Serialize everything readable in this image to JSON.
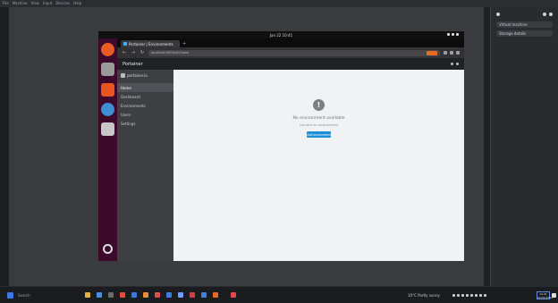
{
  "host": {
    "menu_items": [
      "File",
      "Machine",
      "View",
      "Input",
      "Devices",
      "Help"
    ],
    "right_panel": {
      "dropdown_1": "Virtual machine",
      "dropdown_2": "Storage details"
    }
  },
  "guest": {
    "topbar_clock": "Jan 22  10:41",
    "firefox": {
      "tab_title": "Portainer | Environments",
      "new_tab_symbol": "+",
      "url": "localhost:9000/#!/home",
      "nav_back": "←",
      "nav_forward": "→",
      "nav_reload": "↻"
    },
    "app": {
      "title": "Portainer",
      "sidebar_brand": "portainer.io",
      "sidebar_items": [
        "Home",
        "Dashboard",
        "Environments",
        "Users",
        "Settings"
      ],
      "empty_state": {
        "icon_symbol": "!",
        "title": "No environment available",
        "subtitle": "Connect an environment",
        "button_label": "Add environment"
      }
    }
  },
  "taskbar": {
    "search_placeholder": "Search",
    "weather": "10°C  Partly sunny",
    "clock_time": "10:41",
    "clock_date": "22/01/2024"
  },
  "colors": {
    "desktop_bg": "#3a3b3e",
    "guest_dock": "#3c0b2c",
    "accent_blue": "#1a8fd6",
    "ubuntu_orange": "#e66b1f"
  }
}
